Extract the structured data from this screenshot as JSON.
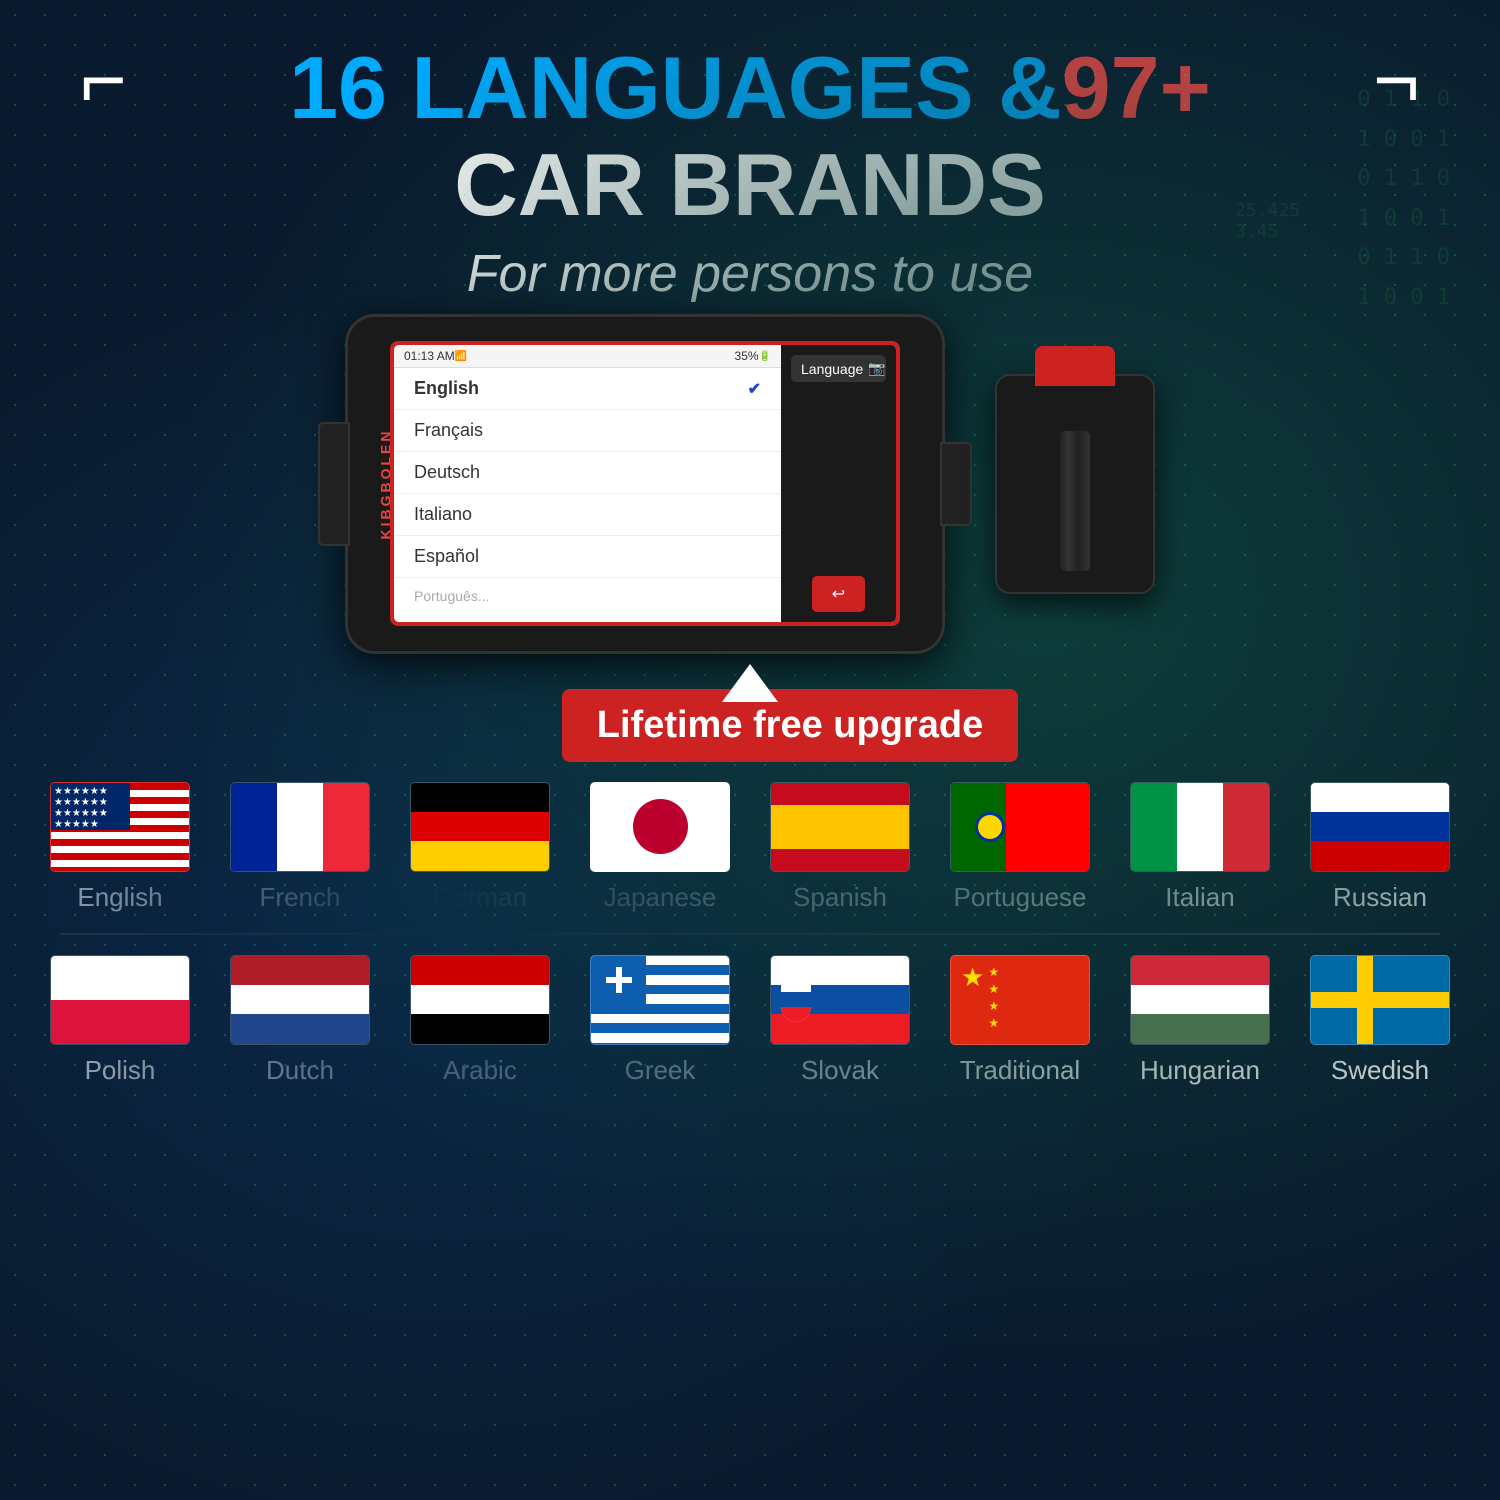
{
  "header": {
    "title_num1": "16",
    "title_text1": " LANGUAGES &",
    "title_num2": "97+",
    "title_line2": "CAR BRANDS",
    "subtitle": "For more persons to use"
  },
  "device": {
    "brand": "KIBGBOLEN",
    "time": "01:13 AM",
    "battery": "35%",
    "selected_lang": "English",
    "languages": [
      "English",
      "Français",
      "Deutsch",
      "Italiano",
      "Español",
      "Português"
    ],
    "sidebar_label": "Language",
    "back_btn": "↩"
  },
  "upgrade": {
    "label": "Lifetime free upgrade",
    "arrow": "▲"
  },
  "flags": {
    "row1": [
      {
        "name": "English",
        "flag": "usa"
      },
      {
        "name": "French",
        "flag": "france"
      },
      {
        "name": "German",
        "flag": "germany"
      },
      {
        "name": "Japanese",
        "flag": "japan"
      },
      {
        "name": "Spanish",
        "flag": "spain"
      },
      {
        "name": "Portuguese",
        "flag": "portugal"
      },
      {
        "name": "Italian",
        "flag": "italy"
      },
      {
        "name": "Russian",
        "flag": "russia"
      }
    ],
    "row2": [
      {
        "name": "Polish",
        "flag": "poland"
      },
      {
        "name": "Dutch",
        "flag": "netherlands"
      },
      {
        "name": "Arabic",
        "flag": "arabic"
      },
      {
        "name": "Greek",
        "flag": "greece"
      },
      {
        "name": "Slovak",
        "flag": "slovakia"
      },
      {
        "name": "Traditional",
        "flag": "china"
      },
      {
        "name": "Hungarian",
        "flag": "hungary"
      },
      {
        "name": "Swedish",
        "flag": "sweden"
      }
    ]
  }
}
